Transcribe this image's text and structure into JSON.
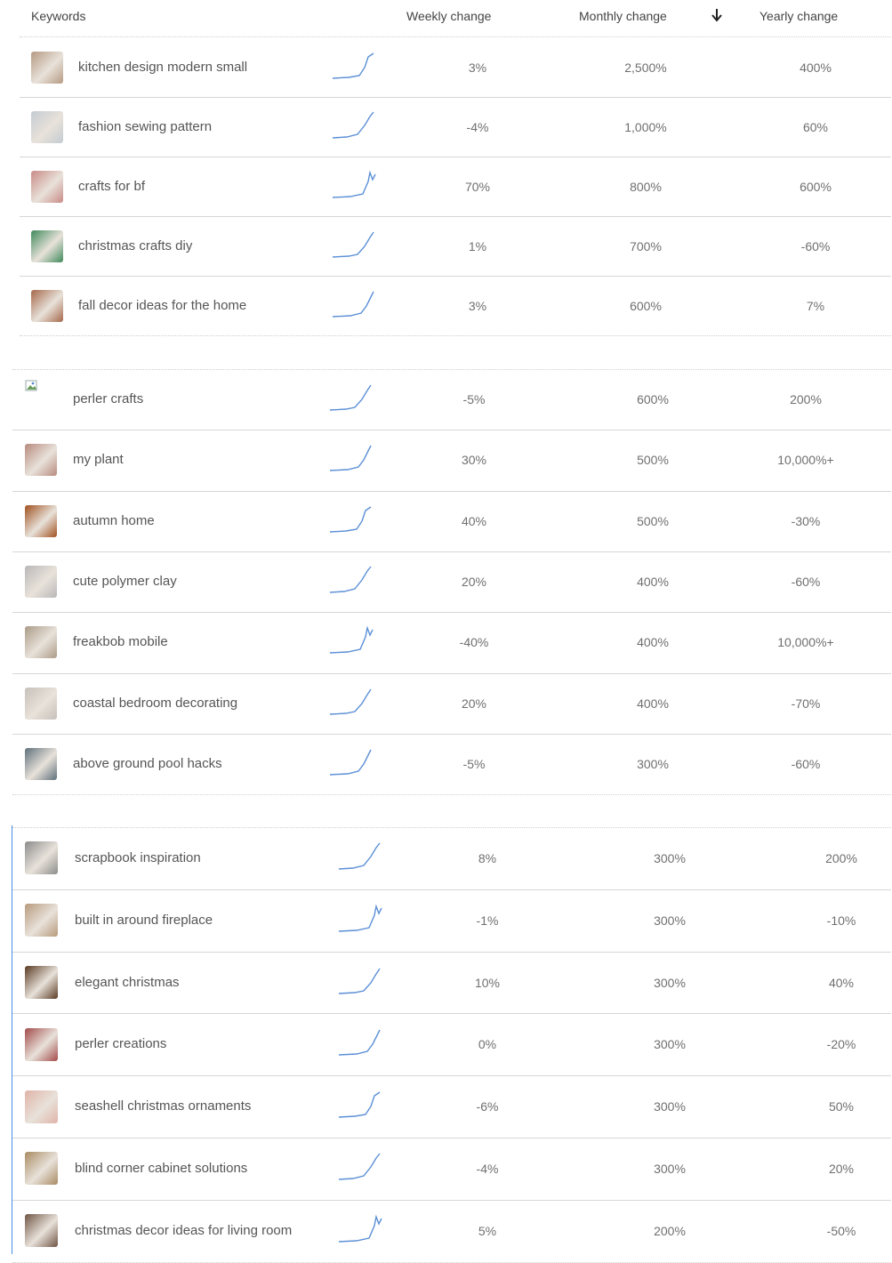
{
  "header": {
    "keywords": "Keywords",
    "weekly": "Weekly change",
    "monthly": "Monthly change",
    "sort_icon": "arrow-down-icon",
    "yearly": "Yearly change"
  },
  "colors": {
    "sparkline": "#5b8fd6",
    "divider": "#d6d6d6",
    "accent_bar": "#4a8ee8"
  },
  "sections": [
    {
      "rows": [
        {
          "keyword": "kitchen design modern small",
          "weekly": "3%",
          "monthly": "2,500%",
          "yearly": "400%",
          "thumb": "#b59a82"
        },
        {
          "keyword": "fashion sewing pattern",
          "weekly": "-4%",
          "monthly": "1,000%",
          "yearly": "60%",
          "thumb": "#c4cbd2"
        },
        {
          "keyword": "crafts for bf",
          "weekly": "70%",
          "monthly": "800%",
          "yearly": "600%",
          "thumb": "#c98a86"
        },
        {
          "keyword": "christmas crafts diy",
          "weekly": "1%",
          "monthly": "700%",
          "yearly": "-60%",
          "thumb": "#3f8a5b"
        },
        {
          "keyword": "fall decor ideas for the home",
          "weekly": "3%",
          "monthly": "600%",
          "yearly": "7%",
          "thumb": "#a6674a"
        }
      ]
    },
    {
      "rows": [
        {
          "keyword": "perler crafts",
          "weekly": "-5%",
          "monthly": "600%",
          "yearly": "200%",
          "thumb": "broken"
        },
        {
          "keyword": "my plant",
          "weekly": "30%",
          "monthly": "500%",
          "yearly": "10,000%+",
          "thumb": "#b88a7e"
        },
        {
          "keyword": "autumn home",
          "weekly": "40%",
          "monthly": "500%",
          "yearly": "-30%",
          "thumb": "#a0501e"
        },
        {
          "keyword": "cute polymer clay",
          "weekly": "20%",
          "monthly": "400%",
          "yearly": "-60%",
          "thumb": "#b9b7b8"
        },
        {
          "keyword": "freakbob mobile",
          "weekly": "-40%",
          "monthly": "400%",
          "yearly": "10,000%+",
          "thumb": "#ab9b86"
        },
        {
          "keyword": "coastal bedroom decorating",
          "weekly": "20%",
          "monthly": "400%",
          "yearly": "-70%",
          "thumb": "#c6c0ba"
        },
        {
          "keyword": "above ground pool hacks",
          "weekly": "-5%",
          "monthly": "300%",
          "yearly": "-60%",
          "thumb": "#5e6f7b"
        }
      ]
    },
    {
      "rows": [
        {
          "keyword": "scrapbook inspiration",
          "weekly": "8%",
          "monthly": "300%",
          "yearly": "200%",
          "thumb": "#8c8c8c"
        },
        {
          "keyword": "built in around fireplace",
          "weekly": "-1%",
          "monthly": "300%",
          "yearly": "-10%",
          "thumb": "#b79a7c"
        },
        {
          "keyword": "elegant christmas",
          "weekly": "10%",
          "monthly": "300%",
          "yearly": "40%",
          "thumb": "#5a3a22"
        },
        {
          "keyword": "perler creations",
          "weekly": "0%",
          "monthly": "300%",
          "yearly": "-20%",
          "thumb": "#a34a4a"
        },
        {
          "keyword": "seashell christmas ornaments",
          "weekly": "-6%",
          "monthly": "300%",
          "yearly": "50%",
          "thumb": "#e0b3a8"
        },
        {
          "keyword": "blind corner cabinet solutions",
          "weekly": "-4%",
          "monthly": "300%",
          "yearly": "20%",
          "thumb": "#a98b62"
        },
        {
          "keyword": "christmas decor ideas for living room",
          "weekly": "5%",
          "monthly": "200%",
          "yearly": "-50%",
          "thumb": "#6f5444"
        }
      ]
    }
  ]
}
